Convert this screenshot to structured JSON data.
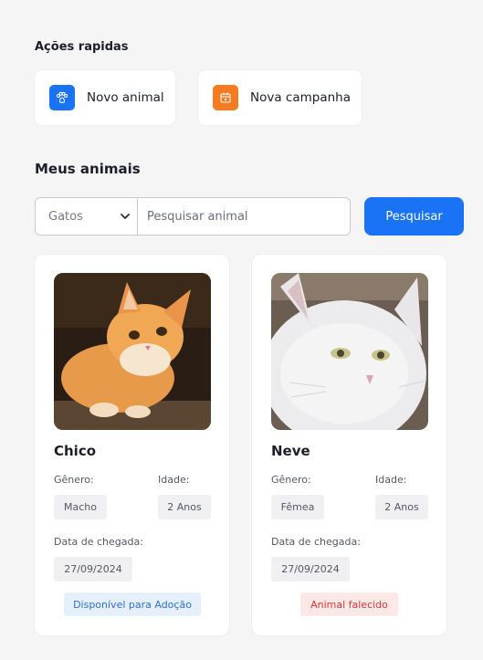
{
  "quick_actions": {
    "title": "Ações rapidas",
    "items": [
      {
        "label": "Novo animal",
        "icon": "paw-icon",
        "color": "#1a73f4"
      },
      {
        "label": "Nova campanha",
        "icon": "calendar-icon",
        "color": "#f47b20"
      }
    ]
  },
  "animals_section": {
    "title": "Meus animais",
    "filter": {
      "selected": "Gatos"
    },
    "search": {
      "placeholder": "Pesquisar animal",
      "value": "",
      "button_label": "Pesquisar"
    }
  },
  "labels": {
    "gender": "Gênero:",
    "age": "Idade:",
    "arrival": "Data de chegada:"
  },
  "animals": [
    {
      "name": "Chico",
      "gender": "Macho",
      "age": "2 Anos",
      "arrival_date": "27/09/2024",
      "status": "Disponível para Adoção",
      "status_color": "#2f6fd6",
      "status_bg": "#e6f0fd"
    },
    {
      "name": "Neve",
      "gender": "Fêmea",
      "age": "2 Anos",
      "arrival_date": "27/09/2024",
      "status": "Animal falecido",
      "status_color": "#d93838",
      "status_bg": "#fde8e8"
    }
  ]
}
